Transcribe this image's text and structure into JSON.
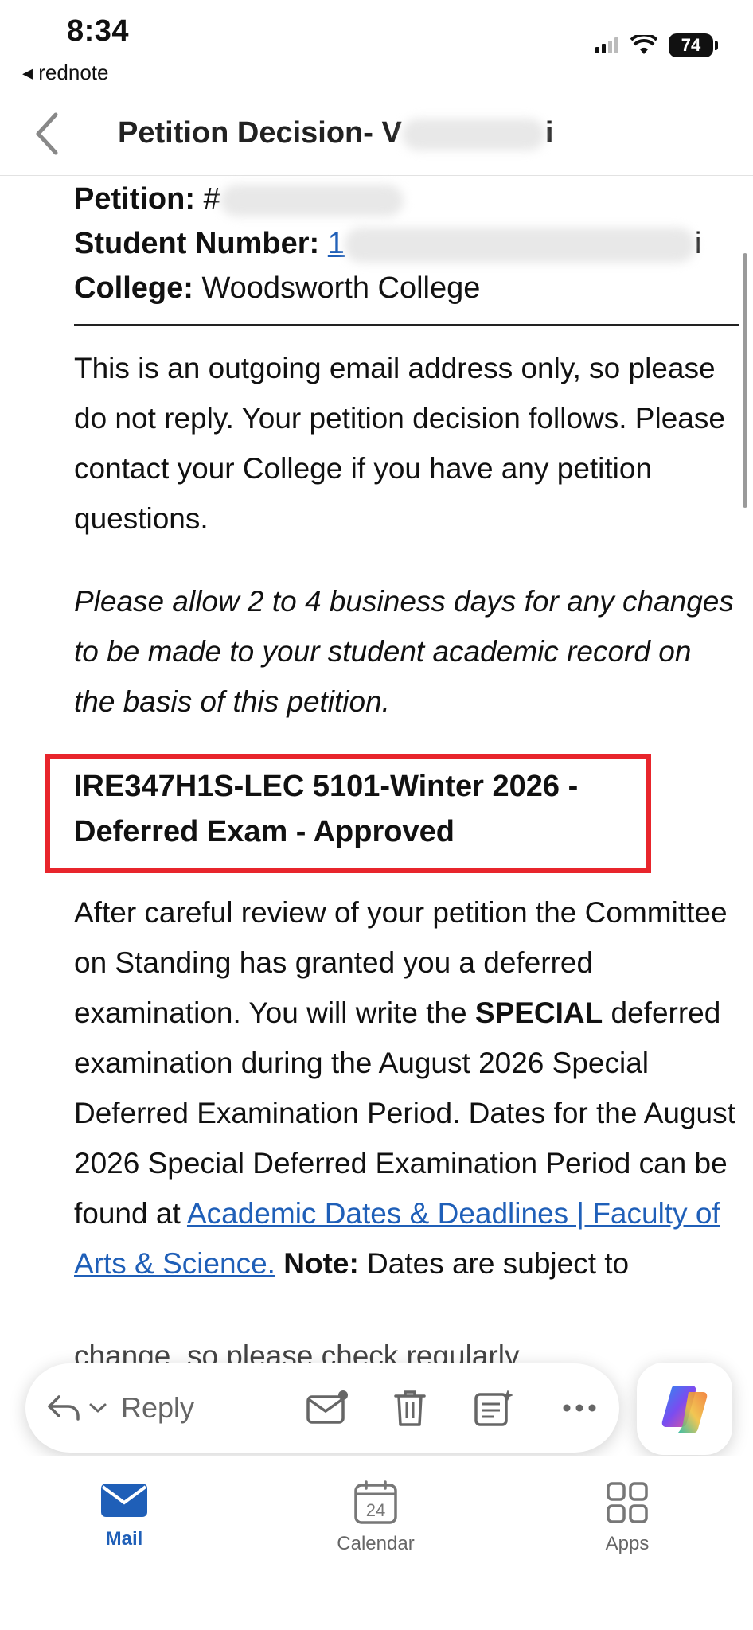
{
  "status_bar": {
    "time": "8:34",
    "back_app": "◂ rednote",
    "battery": "74"
  },
  "header": {
    "title": "Petition Decision- V",
    "title_suffix": "i"
  },
  "meta": {
    "petition_label": "Petition:",
    "petition_value": "#",
    "student_label": "Student Number:",
    "student_value": "1",
    "student_suffix": "i",
    "college_label": "College:",
    "college_value": "Woodsworth College"
  },
  "body": {
    "intro": "This is an outgoing email address only, so please do not reply. Your petition decision follows. Please contact your College if you have any petition questions.",
    "note_italic": "Please allow 2 to 4 business days for any changes to be made to your student academic record on the basis of this petition.",
    "section_title_line1": "IRE347H1S-LEC 5101-Winter 2026 -",
    "section_title_line2": "Deferred Exam - Approved",
    "decision_part1": "After careful review of your petition the Committee on Standing has granted you a deferred examination. You will write the ",
    "decision_bold": "SPECIAL",
    "decision_part2": " deferred examination during the August 2026 Special Deferred Examination Period.  Dates for the August 2026 Special Deferred Examination Period can be found at ",
    "decision_link": "Academic Dates & Deadlines | Faculty of Arts & Science.",
    "note_label": "Note:",
    "note_text": " Dates are subject to",
    "cut_line": "change, so please check regularly."
  },
  "toolbar": {
    "reply_label": "Reply"
  },
  "tabbar": {
    "items": [
      {
        "label": "Mail",
        "active": true
      },
      {
        "label": "Calendar",
        "calendar_day": "24"
      },
      {
        "label": "Apps"
      }
    ]
  },
  "colors": {
    "accent": "#1f5fb8",
    "highlight_box": "#e8252c"
  }
}
